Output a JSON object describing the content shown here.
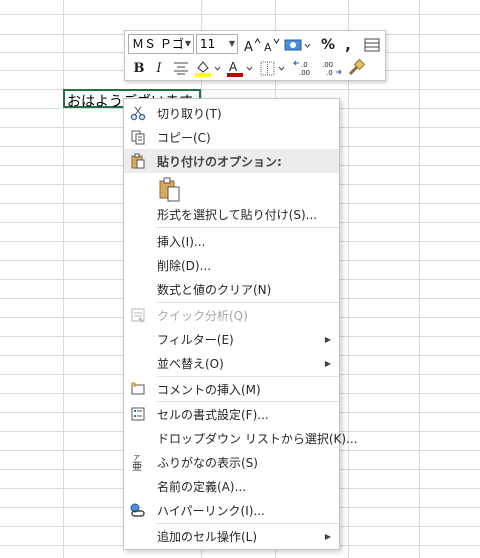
{
  "cell": {
    "text": "おはようございます"
  },
  "mini_toolbar": {
    "font_name": "ＭＳ Ｐゴ",
    "font_size": "11",
    "percent_label": "%",
    "comma_label": ",",
    "bold_label": "B",
    "italic_label": "I",
    "font_color_label": "A",
    "fill_color": "#ffff00",
    "font_color": "#c00000",
    "decimal_increase_label": "←.0\n.00",
    "decimal_decrease_label": ".00\n→.0"
  },
  "menu": {
    "cut": "切り取り(T)",
    "copy": "コピー(C)",
    "paste_header": "貼り付けのオプション:",
    "paste_special": "形式を選択して貼り付け(S)...",
    "insert": "挿入(I)...",
    "delete": "削除(D)...",
    "clear": "数式と値のクリア(N)",
    "quick_analysis": "クイック分析(Q)",
    "filter": "フィルター(E)",
    "sort": "並べ替え(O)",
    "insert_comment": "コメントの挿入(M)",
    "format_cells": "セルの書式設定(F)...",
    "pick_list": "ドロップダウン リストから選択(K)...",
    "show_phonetic": "ふりがなの表示(S)",
    "define_name": "名前の定義(A)...",
    "hyperlink": "ハイパーリンク(I)...",
    "additional_cell_actions": "追加のセル操作(L)"
  }
}
